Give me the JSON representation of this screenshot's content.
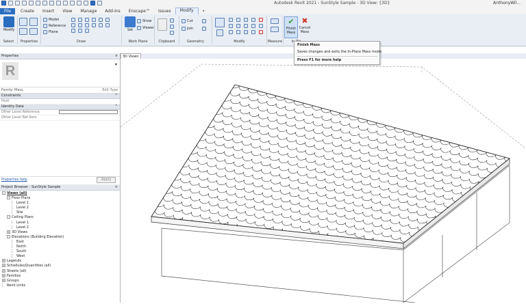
{
  "title_bar": {
    "app_title": "Autodesk Revit 2021 - SunStyle Sample - 3D View: {3D}",
    "user": "AnthonyWil..."
  },
  "tabs": [
    "File",
    "Create",
    "Insert",
    "View",
    "Manage",
    "Add-Ins",
    "Enscape™",
    "Issues",
    "Modify",
    "•"
  ],
  "active_tab": "Modify",
  "ribbon": {
    "select": {
      "modify_label": "Modify",
      "title": "Select"
    },
    "properties": {
      "title": "Properties"
    },
    "draw": {
      "model_label": "Model",
      "reference_label": "Reference",
      "plane_label": "Plane",
      "title": "Draw"
    },
    "work_plane": {
      "set_label": "Set",
      "show_label": "Show",
      "viewer_label": "Viewer",
      "title": "Work Plane"
    },
    "clipboard": {
      "title": "Clipboard"
    },
    "geometry": {
      "cut_label": "Cut",
      "join_label": "Join",
      "title": "Geometry"
    },
    "modify": {
      "title": "Modify"
    },
    "measure": {
      "title": "Measure"
    },
    "in_place": {
      "finish_label": "Finish Mass",
      "cancel_label": "Cancel Mass",
      "title": "In-Pla..."
    }
  },
  "tooltip": {
    "title": "Finish Mass",
    "description": "Saves changes and exits the In-Place Mass mode.",
    "help": "Press F1 for more help"
  },
  "properties_panel": {
    "header": "Properties",
    "filter": "Family: Mass",
    "edit_type": "Edit Type",
    "categories": [
      {
        "name": "Constraints",
        "rows": [
          {
            "label": "Host",
            "value": ""
          }
        ]
      },
      {
        "name": "Identity Data",
        "rows": [
          {
            "label": "Other Level Reference",
            "value": ""
          },
          {
            "label": "Other Level Ref Item",
            "value": ""
          }
        ]
      }
    ],
    "help_link": "Properties help",
    "apply": "Apply"
  },
  "project_browser": {
    "header": "Project Browser - SunStyle Sample",
    "items": [
      {
        "label": "Views (all)",
        "indent": 0,
        "toggle": "-",
        "bold": true
      },
      {
        "label": "Floor Plans",
        "indent": 1,
        "toggle": "-"
      },
      {
        "label": "Level 1",
        "indent": 2,
        "toggle": ""
      },
      {
        "label": "Level 2",
        "indent": 2,
        "toggle": ""
      },
      {
        "label": "Site",
        "indent": 2,
        "toggle": ""
      },
      {
        "label": "Ceiling Plans",
        "indent": 1,
        "toggle": "-"
      },
      {
        "label": "Level 1",
        "indent": 2,
        "toggle": ""
      },
      {
        "label": "Level 2",
        "indent": 2,
        "toggle": ""
      },
      {
        "label": "3D Views",
        "indent": 1,
        "toggle": "+"
      },
      {
        "label": "Elevations (Building Elevation)",
        "indent": 1,
        "toggle": "-"
      },
      {
        "label": "East",
        "indent": 2,
        "toggle": ""
      },
      {
        "label": "North",
        "indent": 2,
        "toggle": ""
      },
      {
        "label": "South",
        "indent": 2,
        "toggle": ""
      },
      {
        "label": "West",
        "indent": 2,
        "toggle": ""
      },
      {
        "label": "Legends",
        "indent": 0,
        "toggle": "+"
      },
      {
        "label": "Schedules/Quantities (all)",
        "indent": 0,
        "toggle": "+"
      },
      {
        "label": "Sheets (all)",
        "indent": 0,
        "toggle": "+"
      },
      {
        "label": "Families",
        "indent": 0,
        "toggle": "+"
      },
      {
        "label": "Groups",
        "indent": 0,
        "toggle": "+"
      },
      {
        "label": "Revit Links",
        "indent": 0,
        "toggle": ""
      }
    ]
  },
  "view_tab": {
    "label": "3D View",
    "close": "×"
  },
  "colors": {
    "accent": "#2b6dbf",
    "ribbon": "#e9eef5",
    "finish_green": "#3a9a3a",
    "cancel_red": "#d03a2a"
  }
}
